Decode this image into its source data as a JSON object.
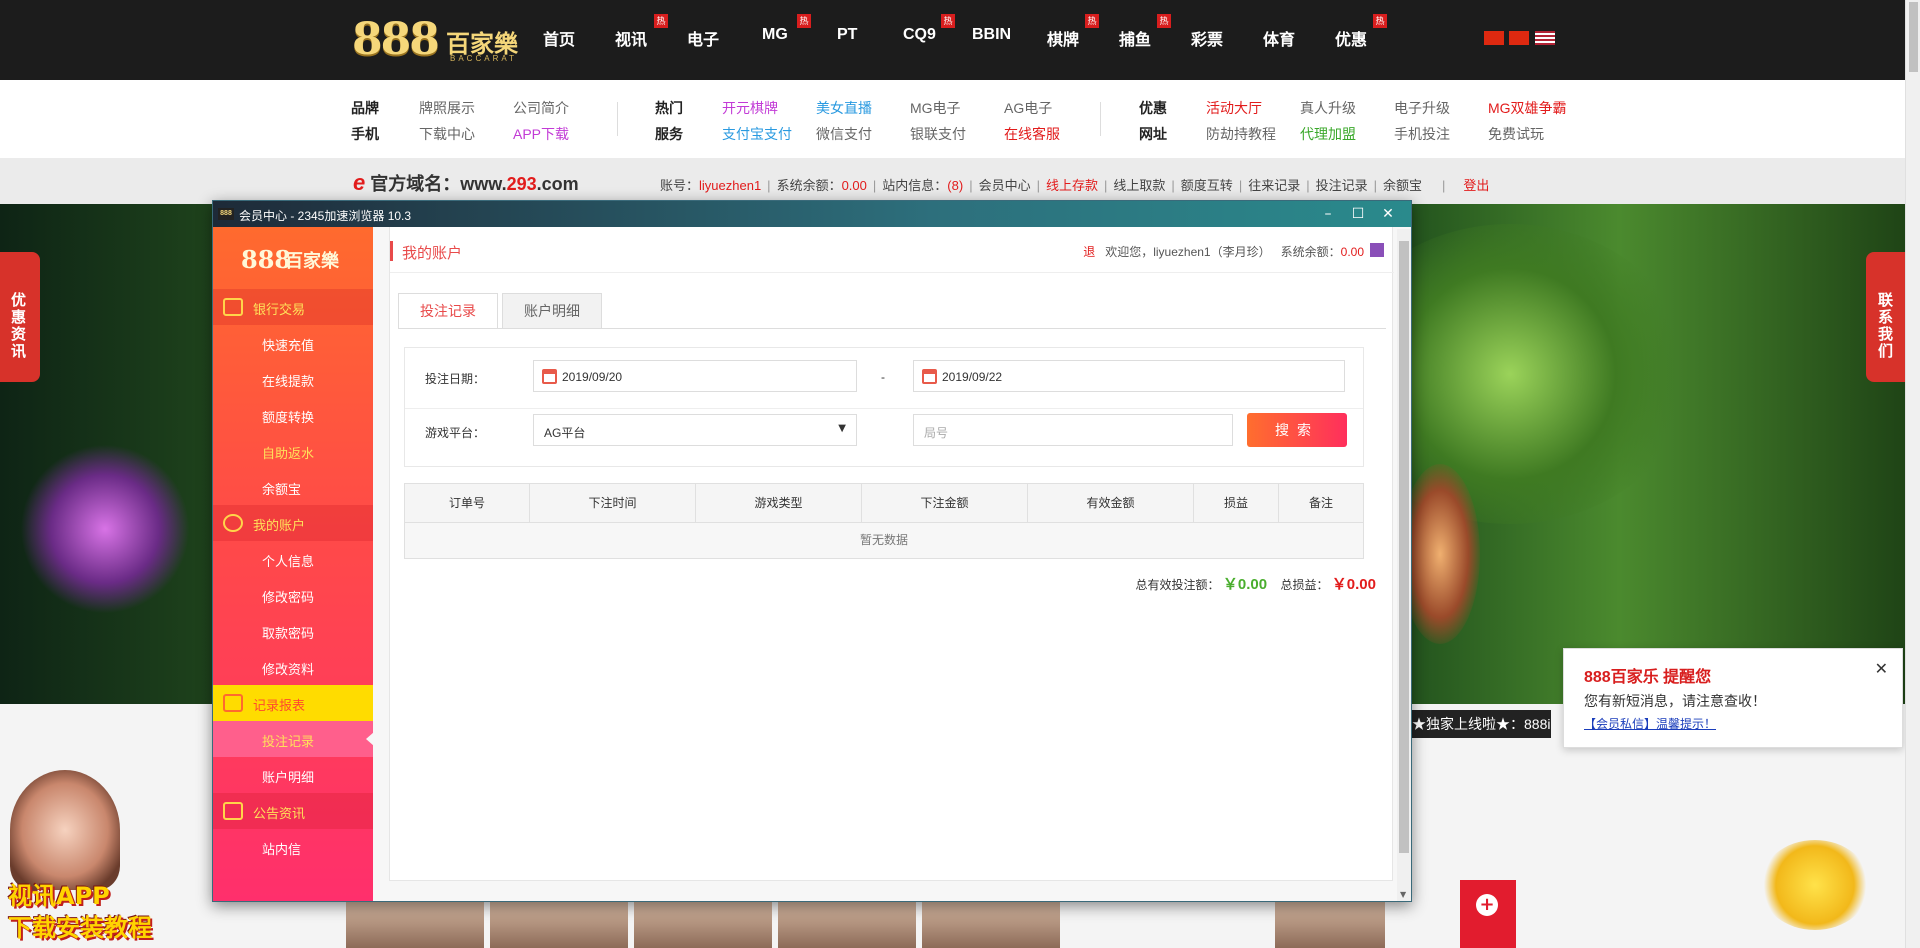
{
  "site": {
    "logo_888": "888",
    "logo_cn": "百家樂",
    "logo_sub": "BACCARAT",
    "nav": [
      {
        "label": "首页",
        "hot": false
      },
      {
        "label": "视讯",
        "hot": true
      },
      {
        "label": "电子",
        "hot": false
      },
      {
        "label": "MG",
        "hot": true
      },
      {
        "label": "PT",
        "hot": false
      },
      {
        "label": "CQ9",
        "hot": true
      },
      {
        "label": "BBIN",
        "hot": false
      },
      {
        "label": "棋牌",
        "hot": true
      },
      {
        "label": "捕鱼",
        "hot": true
      },
      {
        "label": "彩票",
        "hot": false
      },
      {
        "label": "体育",
        "hot": false
      },
      {
        "label": "优惠",
        "hot": true
      }
    ],
    "hot_badge": "热",
    "subnav": {
      "g1_h1": "品牌",
      "g1_h2": "手机",
      "g1_a": "牌照展示",
      "g1_b": "公司简介",
      "g1_c": "下载中心",
      "g1_d": "APP下载",
      "g2_h1": "热门",
      "g2_h2": "服务",
      "g2_a": "开元棋牌",
      "g2_b": "美女直播",
      "g2_c": "MG电子",
      "g2_d": "AG电子",
      "g2_e": "支付宝支付",
      "g2_f": "微信支付",
      "g2_g": "银联支付",
      "g2_h": "在线客服",
      "g3_h1": "优惠",
      "g3_h2": "网址",
      "g3_a": "活动大厅",
      "g3_b": "真人升级",
      "g3_c": "电子升级",
      "g3_d": "MG双雄争霸",
      "g3_e": "防劫持教程",
      "g3_f": "代理加盟",
      "g3_g": "手机投注",
      "g3_h": "免费试玩"
    },
    "domain_label": "官方域名：",
    "domain_pre": "www.",
    "domain_num": "293",
    "domain_post": ".com",
    "account": {
      "acct_label": "账号：",
      "acct_value": "liyuezhen1",
      "bal_label": "系统余额：",
      "bal_value": "0.00",
      "msg_label": "站内信息：",
      "msg_value": "(8)",
      "links": [
        "会员中心",
        "线上存款",
        "线上取款",
        "额度互转",
        "往来记录",
        "投注记录",
        "余额宝"
      ],
      "logout": "登出"
    },
    "side_left": "优惠资讯",
    "side_right": "联系我们",
    "ticker": "★独家上线啦★：888i",
    "app_ad_1": "视讯APP",
    "app_ad_2": "下载安装教程"
  },
  "notification": {
    "title": "888百家乐 提醒您",
    "message": "您有新短消息，请注意查收！",
    "link": "【会员私信】温馨提示！",
    "close": "✕"
  },
  "window": {
    "title": "会员中心 - 2345加速浏览器 10.3",
    "icon_text": "888",
    "min": "–",
    "max": "☐",
    "close": "✕"
  },
  "sidebar": {
    "logo_a": "888",
    "logo_b": "百家樂",
    "sections": [
      {
        "label": "银行交易",
        "items": [
          "快速充值",
          "在线提款",
          "额度转换",
          "自助返水",
          "余额宝"
        ]
      },
      {
        "label": "我的账户",
        "items": [
          "个人信息",
          "修改密码",
          "取款密码",
          "修改资料"
        ]
      },
      {
        "label": "记录报表",
        "items": [
          "投注记录",
          "账户明细"
        ]
      },
      {
        "label": "公告资讯",
        "items": [
          "站内信"
        ]
      }
    ]
  },
  "panel": {
    "title": "我的账户",
    "welcome_icon": "退",
    "welcome": "欢迎您，liyuezhen1（李月珍）",
    "balance_label": "系统余额：",
    "balance_value": "0.00",
    "tabs": [
      "投注记录",
      "账户明细"
    ],
    "form": {
      "date_label": "投注日期：",
      "date_from": "2019/09/20",
      "dash": "-",
      "date_to": "2019/09/22",
      "platform_label": "游戏平台：",
      "platform_value": "AG平台",
      "round_placeholder": "局号",
      "search": "搜索"
    },
    "table": {
      "headers": [
        "订单号",
        "下注时间",
        "游戏类型",
        "下注金额",
        "有效金额",
        "损益",
        "备注"
      ],
      "empty": "暂无数据"
    },
    "totals": {
      "valid_label": "总有效投注额：",
      "valid_value": "￥0.00",
      "pl_label": "总损益：",
      "pl_value": "￥0.00"
    }
  },
  "colors": {
    "accent": "#e84a4a",
    "brand_gold": "#f5d77a",
    "green": "#4aae2e"
  }
}
